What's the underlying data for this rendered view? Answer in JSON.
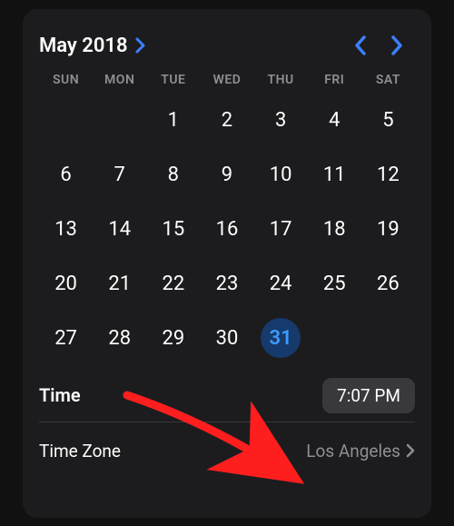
{
  "header": {
    "month_label": "May 2018"
  },
  "weekdays": [
    "SUN",
    "MON",
    "TUE",
    "WED",
    "THU",
    "FRI",
    "SAT"
  ],
  "days": [
    "",
    "",
    "1",
    "2",
    "3",
    "4",
    "5",
    "6",
    "7",
    "8",
    "9",
    "10",
    "11",
    "12",
    "13",
    "14",
    "15",
    "16",
    "17",
    "18",
    "19",
    "20",
    "21",
    "22",
    "23",
    "24",
    "25",
    "26",
    "27",
    "28",
    "29",
    "30",
    "31",
    "",
    ""
  ],
  "selected_day": "31",
  "time": {
    "label": "Time",
    "value": "7:07 PM"
  },
  "timezone": {
    "label": "Time Zone",
    "value": "Los Angeles"
  },
  "colors": {
    "accent": "#3d7fff"
  }
}
